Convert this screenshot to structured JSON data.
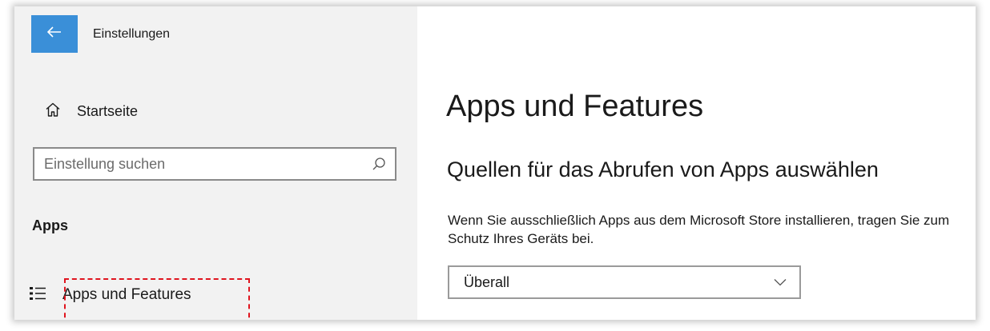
{
  "window": {
    "title": "Einstellungen"
  },
  "sidebar": {
    "home_label": "Startseite",
    "search": {
      "placeholder": "Einstellung suchen",
      "value": ""
    },
    "section_heading": "Apps",
    "items": [
      {
        "label": "Apps und Features",
        "icon": "list-icon",
        "highlighted": true
      }
    ]
  },
  "main": {
    "title": "Apps und Features",
    "subtitle": "Quellen für das Abrufen von Apps auswählen",
    "description": "Wenn Sie ausschließlich Apps aus dem Microsoft Store installieren, tragen Sie zum Schutz Ihres Geräts bei.",
    "source_select": {
      "value": "Überall"
    }
  },
  "colors": {
    "accent": "#3a8fd8",
    "sidebar_bg": "#f2f2f2",
    "highlight": "#e0141e"
  }
}
